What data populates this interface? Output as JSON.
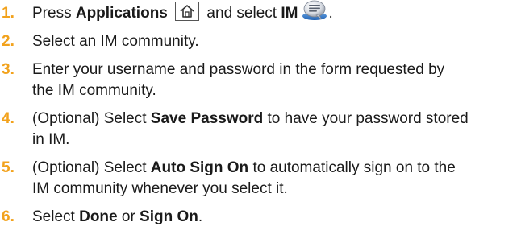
{
  "steps": [
    {
      "num": "1.",
      "parts": {
        "t1": "Press ",
        "b1": "Applications",
        "t2": " and select ",
        "b2": "IM",
        "t3": "."
      },
      "icons": [
        "home-key-icon",
        "im-app-icon"
      ]
    },
    {
      "num": "2.",
      "text": "Select an IM community."
    },
    {
      "num": "3.",
      "line1": "Enter your username and password in the form requested by",
      "line2": "the IM community."
    },
    {
      "num": "4.",
      "parts": {
        "t1": "(Optional) Select ",
        "b1": "Save Password",
        "t2": " to have your password stored"
      },
      "line2": "in IM."
    },
    {
      "num": "5.",
      "parts": {
        "t1": "(Optional) Select ",
        "b1": "Auto Sign On",
        "t2": " to automatically sign on to the"
      },
      "line2": "IM community whenever you select it."
    },
    {
      "num": "6.",
      "parts": {
        "t1": "Select ",
        "b1": "Done",
        "t2": " or ",
        "b2": "Sign On",
        "t3": "."
      }
    }
  ],
  "colors": {
    "step_number": "#f2a21c",
    "text": "#1a1a1a"
  }
}
